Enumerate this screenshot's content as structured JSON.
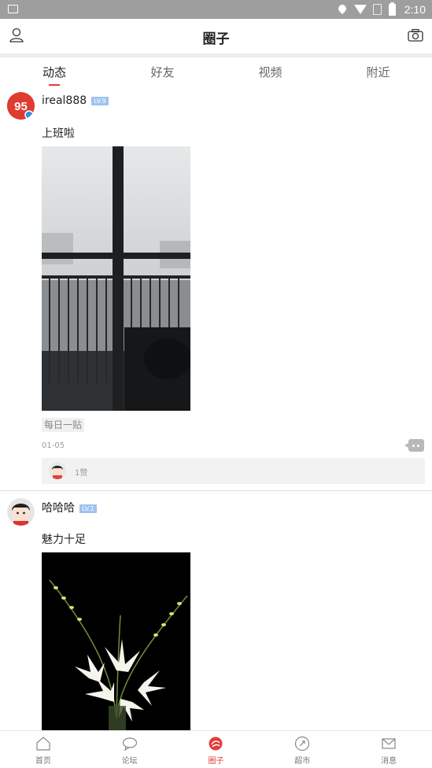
{
  "status_bar": {
    "time": "2:10"
  },
  "header": {
    "title": "圈子",
    "user_icon": "user-icon",
    "camera_icon": "camera-icon"
  },
  "tabs": [
    {
      "label": "动态",
      "active": true
    },
    {
      "label": "好友",
      "active": false
    },
    {
      "label": "视频",
      "active": false
    },
    {
      "label": "附近",
      "active": false
    }
  ],
  "posts": [
    {
      "username": "ireal888",
      "level": "LV.9",
      "avatar_text": "95",
      "text": "上班啦",
      "image_alt": "window view",
      "tag": "每日一贴",
      "date": "01-05",
      "likes": "1赞"
    },
    {
      "username": "哈哈哈",
      "level": "LV.1",
      "text": "魅力十足",
      "image_alt": "lily flowers"
    }
  ],
  "bottom_nav": [
    {
      "label": "首页",
      "icon": "home-icon",
      "active": false
    },
    {
      "label": "论坛",
      "icon": "chat-icon",
      "active": false
    },
    {
      "label": "圈子",
      "icon": "circle-icon",
      "active": true
    },
    {
      "label": "超市",
      "icon": "market-icon",
      "active": false
    },
    {
      "label": "消息",
      "icon": "mail-icon",
      "active": false
    }
  ],
  "colors": {
    "accent": "#e43b3b",
    "level_badge": "#9ec3ee",
    "status_bar": "#9e9e9e"
  }
}
